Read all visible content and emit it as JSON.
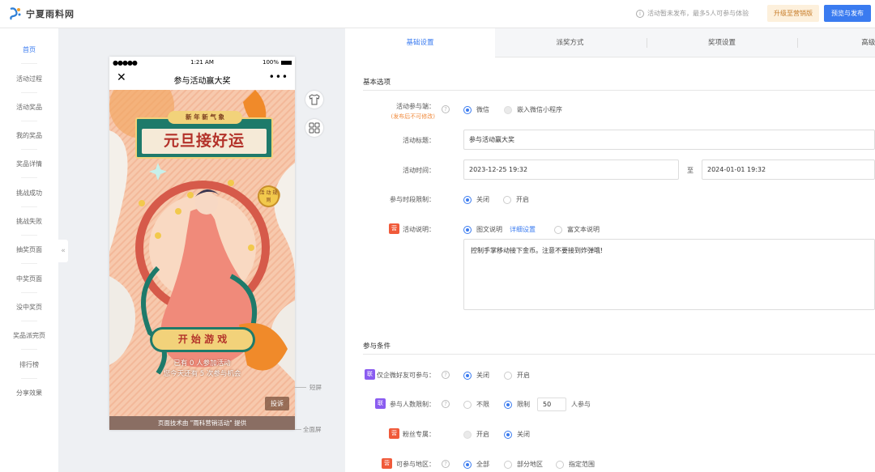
{
  "brand": {
    "name": "宁夏雨料网"
  },
  "header": {
    "notice": "活动暂未发布，最多5人可参与体验",
    "upgrade_label": "升级至营销版",
    "publish_label": "预览与发布"
  },
  "sidebar": {
    "items": [
      {
        "label": "首页",
        "active": true
      },
      {
        "label": "活动过程"
      },
      {
        "label": "活动奖品"
      },
      {
        "label": "我的奖品"
      },
      {
        "label": "奖品详情"
      },
      {
        "label": "挑战成功"
      },
      {
        "label": "挑战失败"
      },
      {
        "label": "抽奖页面"
      },
      {
        "label": "中奖页面"
      },
      {
        "label": "没中奖页"
      },
      {
        "label": "奖品派完页"
      },
      {
        "label": "排行榜"
      },
      {
        "label": "分享效果"
      }
    ],
    "collapse_icon": "«"
  },
  "phone": {
    "signal": "●●●●●",
    "time": "1:21 AM",
    "battery": "100%",
    "title": "参与活动赢大奖",
    "close": "✕",
    "more": "•••",
    "poster": {
      "top_banner": "新 年 新 气 象",
      "title": "元旦接好运",
      "coin_text": "活 动 规 则",
      "start_button": "开 始 游 戏",
      "stat_line1": "已有 0 人参加活动",
      "stat_line2": "您今天还有 5 次参与机会",
      "complain": "投诉"
    },
    "powered_by": "页面技术由 \"雨科营销活动\" 提供"
  },
  "markers": {
    "short": "短屏",
    "full": "全面屏"
  },
  "tabs": [
    {
      "label": "基础设置",
      "active": true
    },
    {
      "label": "派奖方式"
    },
    {
      "label": "奖项设置"
    },
    {
      "label": "高级设"
    }
  ],
  "form": {
    "section_basic": "基本选项",
    "participation": {
      "label": "活动参与端：",
      "hint": "(发布后不可修改)",
      "options": [
        "微信",
        "嵌入微信小程序"
      ],
      "selected": 0
    },
    "title": {
      "label": "活动标题：",
      "value": "参与活动赢大奖"
    },
    "time": {
      "label": "活动时间：",
      "start": "2023-12-25 19:32",
      "to": "至",
      "end": "2024-01-01 19:32"
    },
    "period_limit": {
      "label": "参与时段限制：",
      "options": [
        "关闭",
        "开启"
      ],
      "selected": 0
    },
    "description": {
      "tag": "营",
      "label": "活动说明：",
      "options": [
        "图文说明",
        "富文本说明"
      ],
      "detail_link": "详细设置",
      "selected": 0,
      "text": "控制手掌移动接下金币。注意不要接到炸弹哦!"
    },
    "section_cond": "参与条件",
    "wecom_friend": {
      "tag": "联",
      "label": "仅企微好友可参与：",
      "options": [
        "关闭",
        "开启"
      ],
      "selected": 0
    },
    "people_limit": {
      "tag": "联",
      "label": "参与人数限制：",
      "options": [
        "不限",
        "限制"
      ],
      "selected": 1,
      "value": "50",
      "suffix": "人参与"
    },
    "fans_only": {
      "tag": "营",
      "label": "粉丝专属：",
      "options": [
        "开启",
        "关闭"
      ],
      "selected": 1
    },
    "region": {
      "tag": "营",
      "label": "可参与地区：",
      "options": [
        "全部",
        "部分地区",
        "指定范围"
      ],
      "selected": 0
    }
  },
  "colors": {
    "accent": "#3a7bf0",
    "upgrade_bg": "#fdf0dc",
    "tag_orange": "#f05a3a",
    "tag_purple": "#8a5cf0",
    "poster_teal": "#1e7a6a"
  }
}
